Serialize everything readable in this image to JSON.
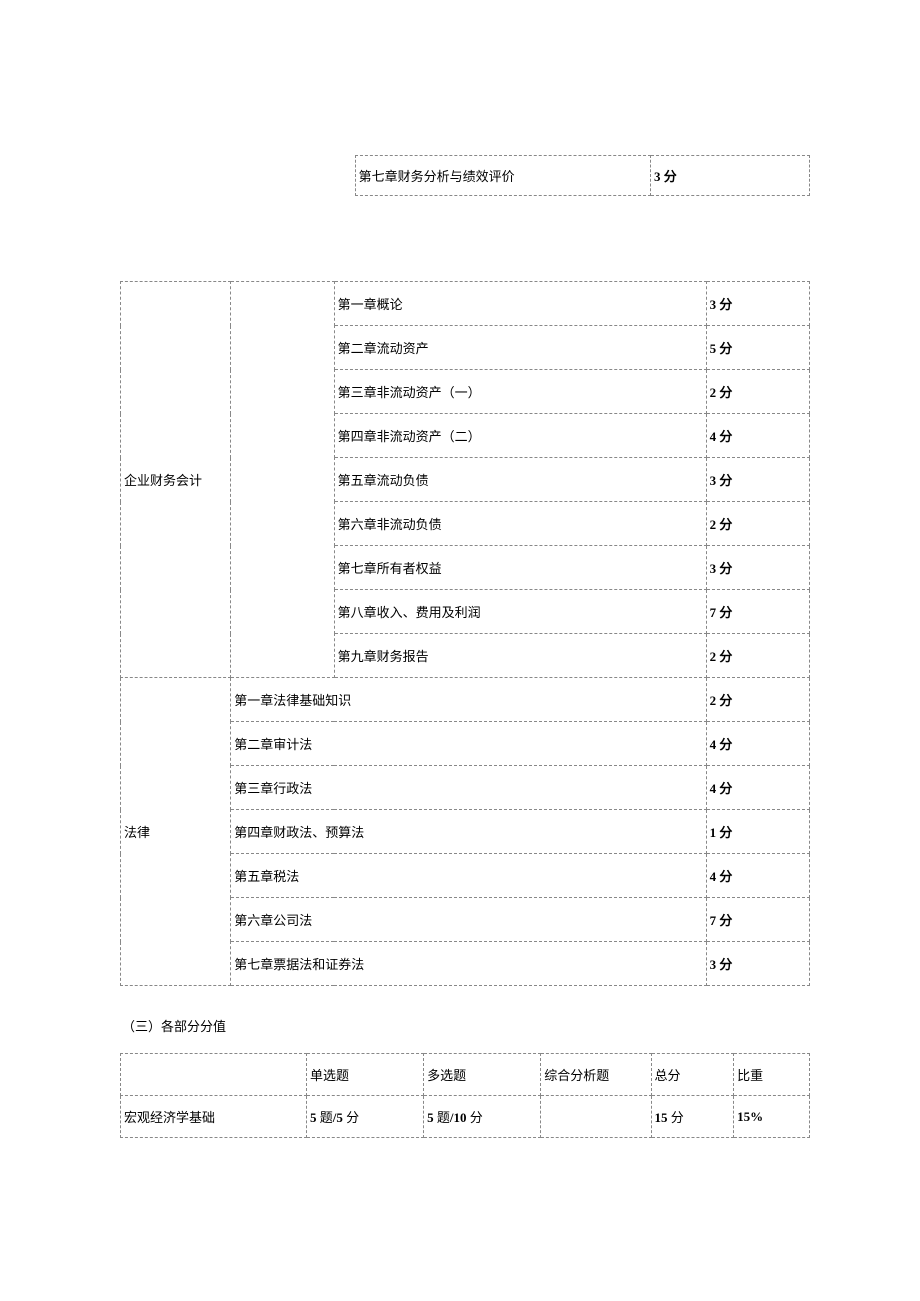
{
  "topTable": {
    "chapter": "第七章财务分析与绩效评价",
    "score": "3 分"
  },
  "mainTable": {
    "section1": {
      "title": "企业财务会计",
      "rows": [
        {
          "chapter": "第一章概论",
          "score": "3 分"
        },
        {
          "chapter": "第二章流动资产",
          "score": "5 分"
        },
        {
          "chapter": "第三章非流动资产（一）",
          "score": "2 分"
        },
        {
          "chapter": "第四章非流动资产（二）",
          "score": "4 分"
        },
        {
          "chapter": "第五章流动负债",
          "score": "3 分"
        },
        {
          "chapter": "第六章非流动负债",
          "score": "2 分"
        },
        {
          "chapter": "第七章所有者权益",
          "score": "3 分"
        },
        {
          "chapter": "第八章收入、费用及利润",
          "score": "7 分"
        },
        {
          "chapter": "第九章财务报告",
          "score": "2 分"
        }
      ]
    },
    "section2": {
      "title": "法律",
      "rows": [
        {
          "chapter": "第一章法律基础知识",
          "score": "2 分"
        },
        {
          "chapter": "第二章审计法",
          "score": "4 分"
        },
        {
          "chapter": "第三章行政法",
          "score": "4 分"
        },
        {
          "chapter": "第四章财政法、预算法",
          "score": "1 分"
        },
        {
          "chapter": "第五章税法",
          "score": "4 分"
        },
        {
          "chapter": "第六章公司法",
          "score": "7 分"
        },
        {
          "chapter": "第七章票据法和证券法",
          "score": "3 分"
        }
      ]
    }
  },
  "sectionHeading": "（三）各部分分值",
  "scoresTable": {
    "header": {
      "c1": "",
      "c2": "单选题",
      "c3": "多选题",
      "c4": "综合分析题",
      "c5": "总分",
      "c6": "比重"
    },
    "row1": {
      "c1": "宏观经济学基础",
      "c2_a": "5",
      "c2_b": " 题",
      "c2_c": "/5",
      "c2_d": " 分",
      "c3_a": "5",
      "c3_b": " 题",
      "c3_c": "/10",
      "c3_d": " 分",
      "c4": "",
      "c5_a": "15",
      "c5_b": " 分",
      "c6": "15%"
    }
  }
}
